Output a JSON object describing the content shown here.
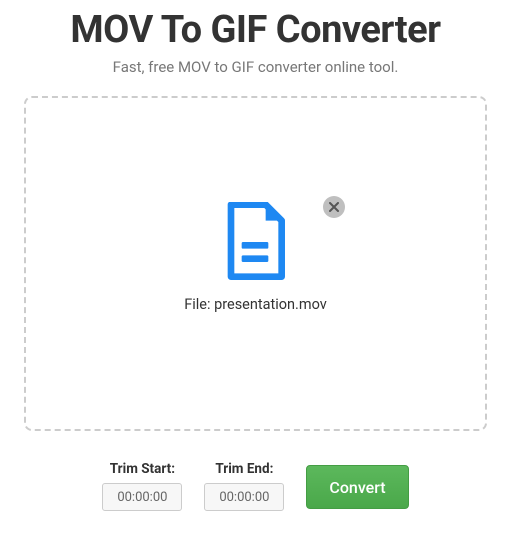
{
  "header": {
    "title": "MOV To GIF Converter",
    "subtitle": "Fast, free MOV to GIF converter online tool."
  },
  "dropzone": {
    "file_prefix": "File: ",
    "file_name": "presentation.mov"
  },
  "controls": {
    "trim_start_label": "Trim Start:",
    "trim_start_value": "00:00:00",
    "trim_end_label": "Trim End:",
    "trim_end_value": "00:00:00",
    "convert_label": "Convert"
  },
  "colors": {
    "accent_blue": "#1e88f2",
    "convert_green": "#51a351"
  }
}
